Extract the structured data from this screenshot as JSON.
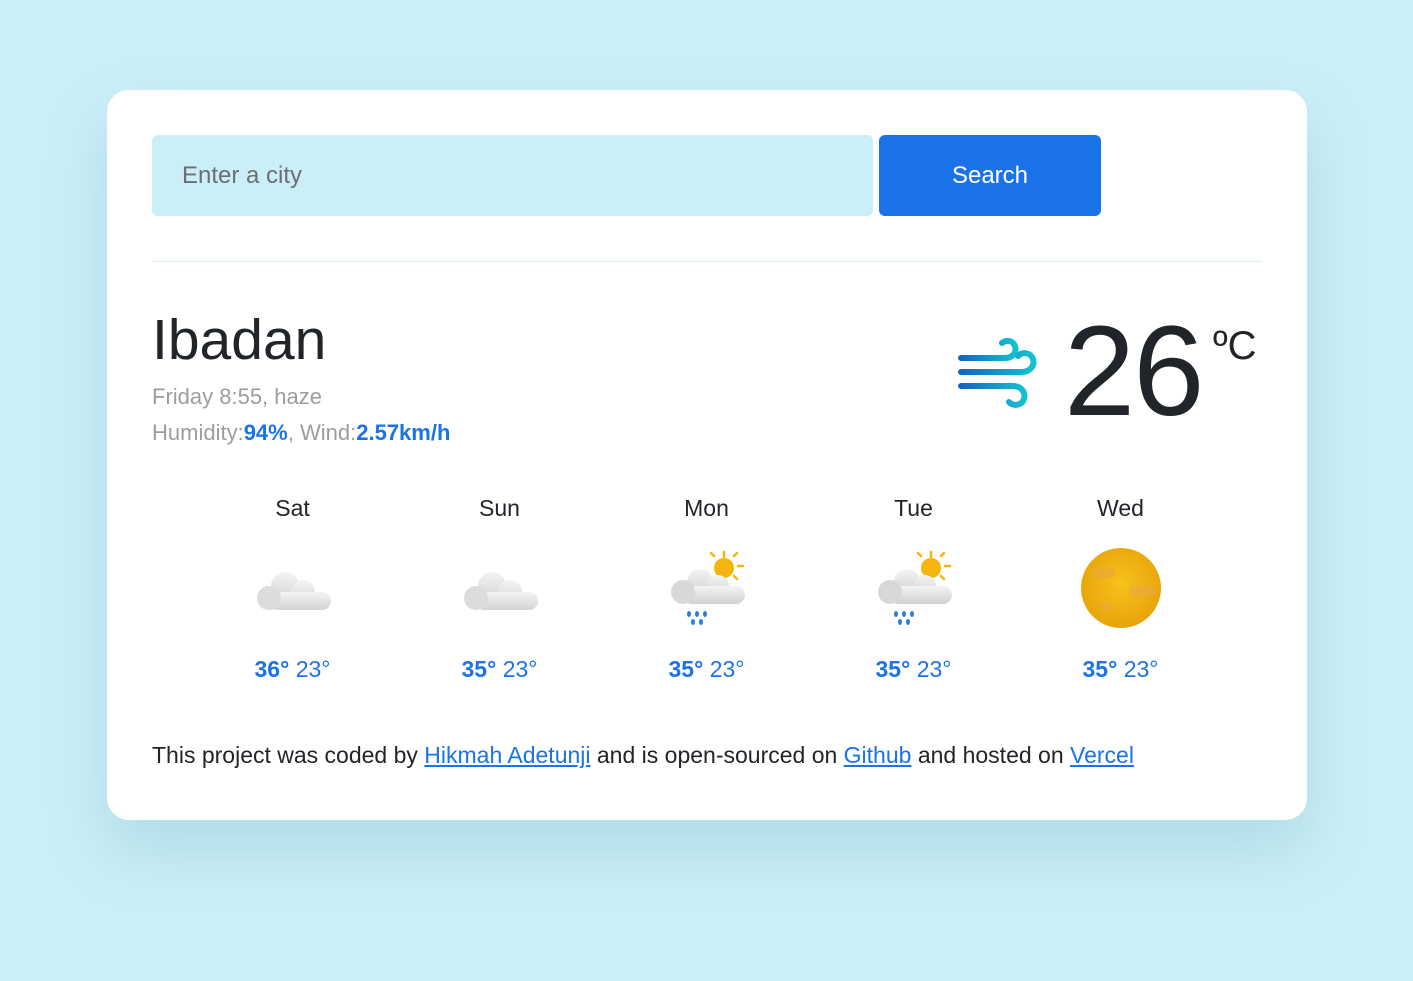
{
  "search": {
    "placeholder": "Enter a city",
    "button_label": "Search"
  },
  "current": {
    "city": "Ibadan",
    "time_line": "Friday 8:55, haze",
    "humidity_label": "Humidity:",
    "humidity_value": "94%",
    "separator": ", ",
    "wind_label": "Wind:",
    "wind_value": "2.57km/h",
    "icon": "wind-icon",
    "temperature": "26",
    "unit": "ºC"
  },
  "forecast": [
    {
      "day": "Sat",
      "icon": "cloud-icon",
      "max": "36°",
      "min": "23°"
    },
    {
      "day": "Sun",
      "icon": "cloud-icon",
      "max": "35°",
      "min": "23°"
    },
    {
      "day": "Mon",
      "icon": "sun-rain-cloud-icon",
      "max": "35°",
      "min": "23°"
    },
    {
      "day": "Tue",
      "icon": "sun-rain-cloud-icon",
      "max": "35°",
      "min": "23°"
    },
    {
      "day": "Wed",
      "icon": "haze-sun-icon",
      "max": "35°",
      "min": "23°"
    }
  ],
  "footer": {
    "prefix": "This project was coded by ",
    "author_link": "Hikmah Adetunji",
    "middle": " and is open-sourced on ",
    "github_link": "Github",
    "middle2": " and hosted on ",
    "vercel_link": "Vercel"
  },
  "colors": {
    "background": "#cbeff7",
    "accent": "#1a73e8",
    "text": "#212529",
    "muted": "#9b9da1"
  }
}
